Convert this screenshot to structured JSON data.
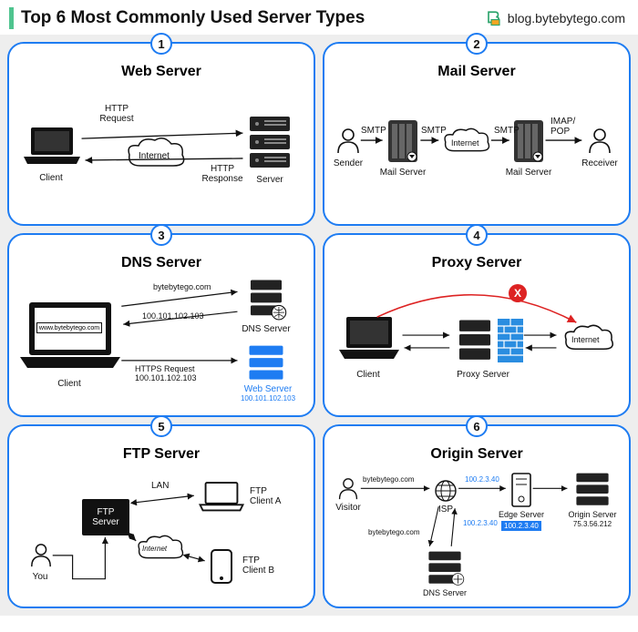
{
  "header": {
    "title": "Top 6 Most Commonly Used Server Types",
    "brand": "blog.bytebytego.com"
  },
  "panels": [
    {
      "num": "1",
      "title": "Web Server",
      "labels": {
        "client": "Client",
        "internet": "Internet",
        "server": "Server",
        "req": "HTTP\nRequest",
        "resp": "HTTP\nResponse"
      }
    },
    {
      "num": "2",
      "title": "Mail Server",
      "labels": {
        "sender": "Sender",
        "ms": "Mail Server",
        "internet": "Internet",
        "receiver": "Receiver",
        "smtp": "SMTP",
        "imap": "IMAP/\nPOP"
      }
    },
    {
      "num": "3",
      "title": "DNS Server",
      "labels": {
        "client": "Client",
        "dns": "DNS Server",
        "web": "Web Server",
        "url": "www.bytebytego.com",
        "domain": "bytebytego.com",
        "ip": "100.101.102.103",
        "httpsReq": "HTTPS Request\n100.101.102.103",
        "webIp": "100.101.102.103"
      }
    },
    {
      "num": "4",
      "title": "Proxy Server",
      "labels": {
        "client": "Client",
        "proxy": "Proxy Server",
        "internet": "Internet",
        "x": "X"
      }
    },
    {
      "num": "5",
      "title": "FTP Server",
      "labels": {
        "you": "You",
        "ftp": "FTP\nServer",
        "lan": "LAN",
        "internet": "Internet",
        "ca": "FTP\nClient A",
        "cb": "FTP\nClient B"
      }
    },
    {
      "num": "6",
      "title": "Origin Server",
      "labels": {
        "visitor": "Visitor",
        "domain": "bytebytego.com",
        "isp": "ISP",
        "edge": "Edge Server",
        "origin": "Origin Server",
        "dns": "DNS Server",
        "ip1": "100.2.3.40",
        "ip2": "75.3.56.212"
      }
    }
  ]
}
